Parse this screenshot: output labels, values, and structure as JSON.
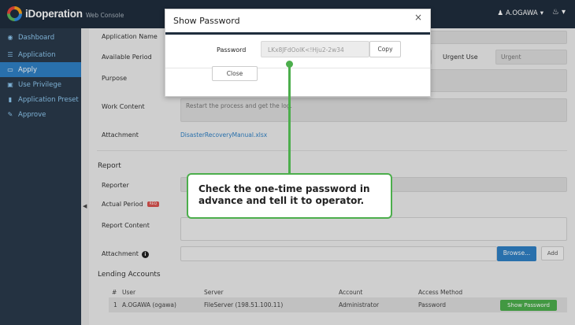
{
  "app": {
    "logo_name": "iDoperation",
    "logo_sub": "Web Console",
    "user": "A.OGAWA"
  },
  "sidebar": {
    "items": [
      {
        "label": "Dashboard",
        "icon": "dashboard-icon"
      },
      {
        "label": "Application",
        "icon": "list-icon"
      },
      {
        "label": "Apply",
        "icon": "folder-icon"
      },
      {
        "label": "Use Privilege",
        "icon": "monitor-icon"
      },
      {
        "label": "Application Preset",
        "icon": "bookmark-icon"
      },
      {
        "label": "Approve",
        "icon": "edit-icon"
      }
    ]
  },
  "form": {
    "application_name_label": "Application Name",
    "available_period_label": "Available Period",
    "urgent_use_label": "Urgent Use",
    "urgent_value": "Urgent",
    "purpose_label": "Purpose",
    "work_content_label": "Work Content",
    "work_content_value": "Restart the process and get the log.",
    "attachment_label": "Attachment",
    "attachment_file": "DisasterRecoveryManual.xlsx"
  },
  "report": {
    "section_title": "Report",
    "reporter_label": "Reporter",
    "actual_period_label": "Actual Period",
    "report_content_label": "Report Content",
    "attachment_label": "Attachment",
    "browse_label": "Browse...",
    "add_label": "Add"
  },
  "lending": {
    "section_title": "Lending Accounts",
    "columns": [
      "#",
      "User",
      "Server",
      "Account",
      "Access Method"
    ],
    "rows": [
      {
        "num": "1",
        "user": "A.OGAWA (ogawa)",
        "server": "FileServer (198.51.100.11)",
        "account": "Administrator",
        "access": "Password",
        "action": "Show Password"
      }
    ]
  },
  "modal": {
    "title": "Show Password",
    "close_symbol": "×",
    "password_label": "Password",
    "password_value": "LKx8JFdOolK<!Hju2-2w34",
    "copy_label": "Copy",
    "close_label": "Close"
  },
  "callout": {
    "text": "Check the one-time password in advance and tell it to operator."
  },
  "colors": {
    "accent": "#2f80c4",
    "success": "#4cae4c",
    "topbar": "#1f2d3d",
    "sidebar": "#2a3a4b"
  }
}
